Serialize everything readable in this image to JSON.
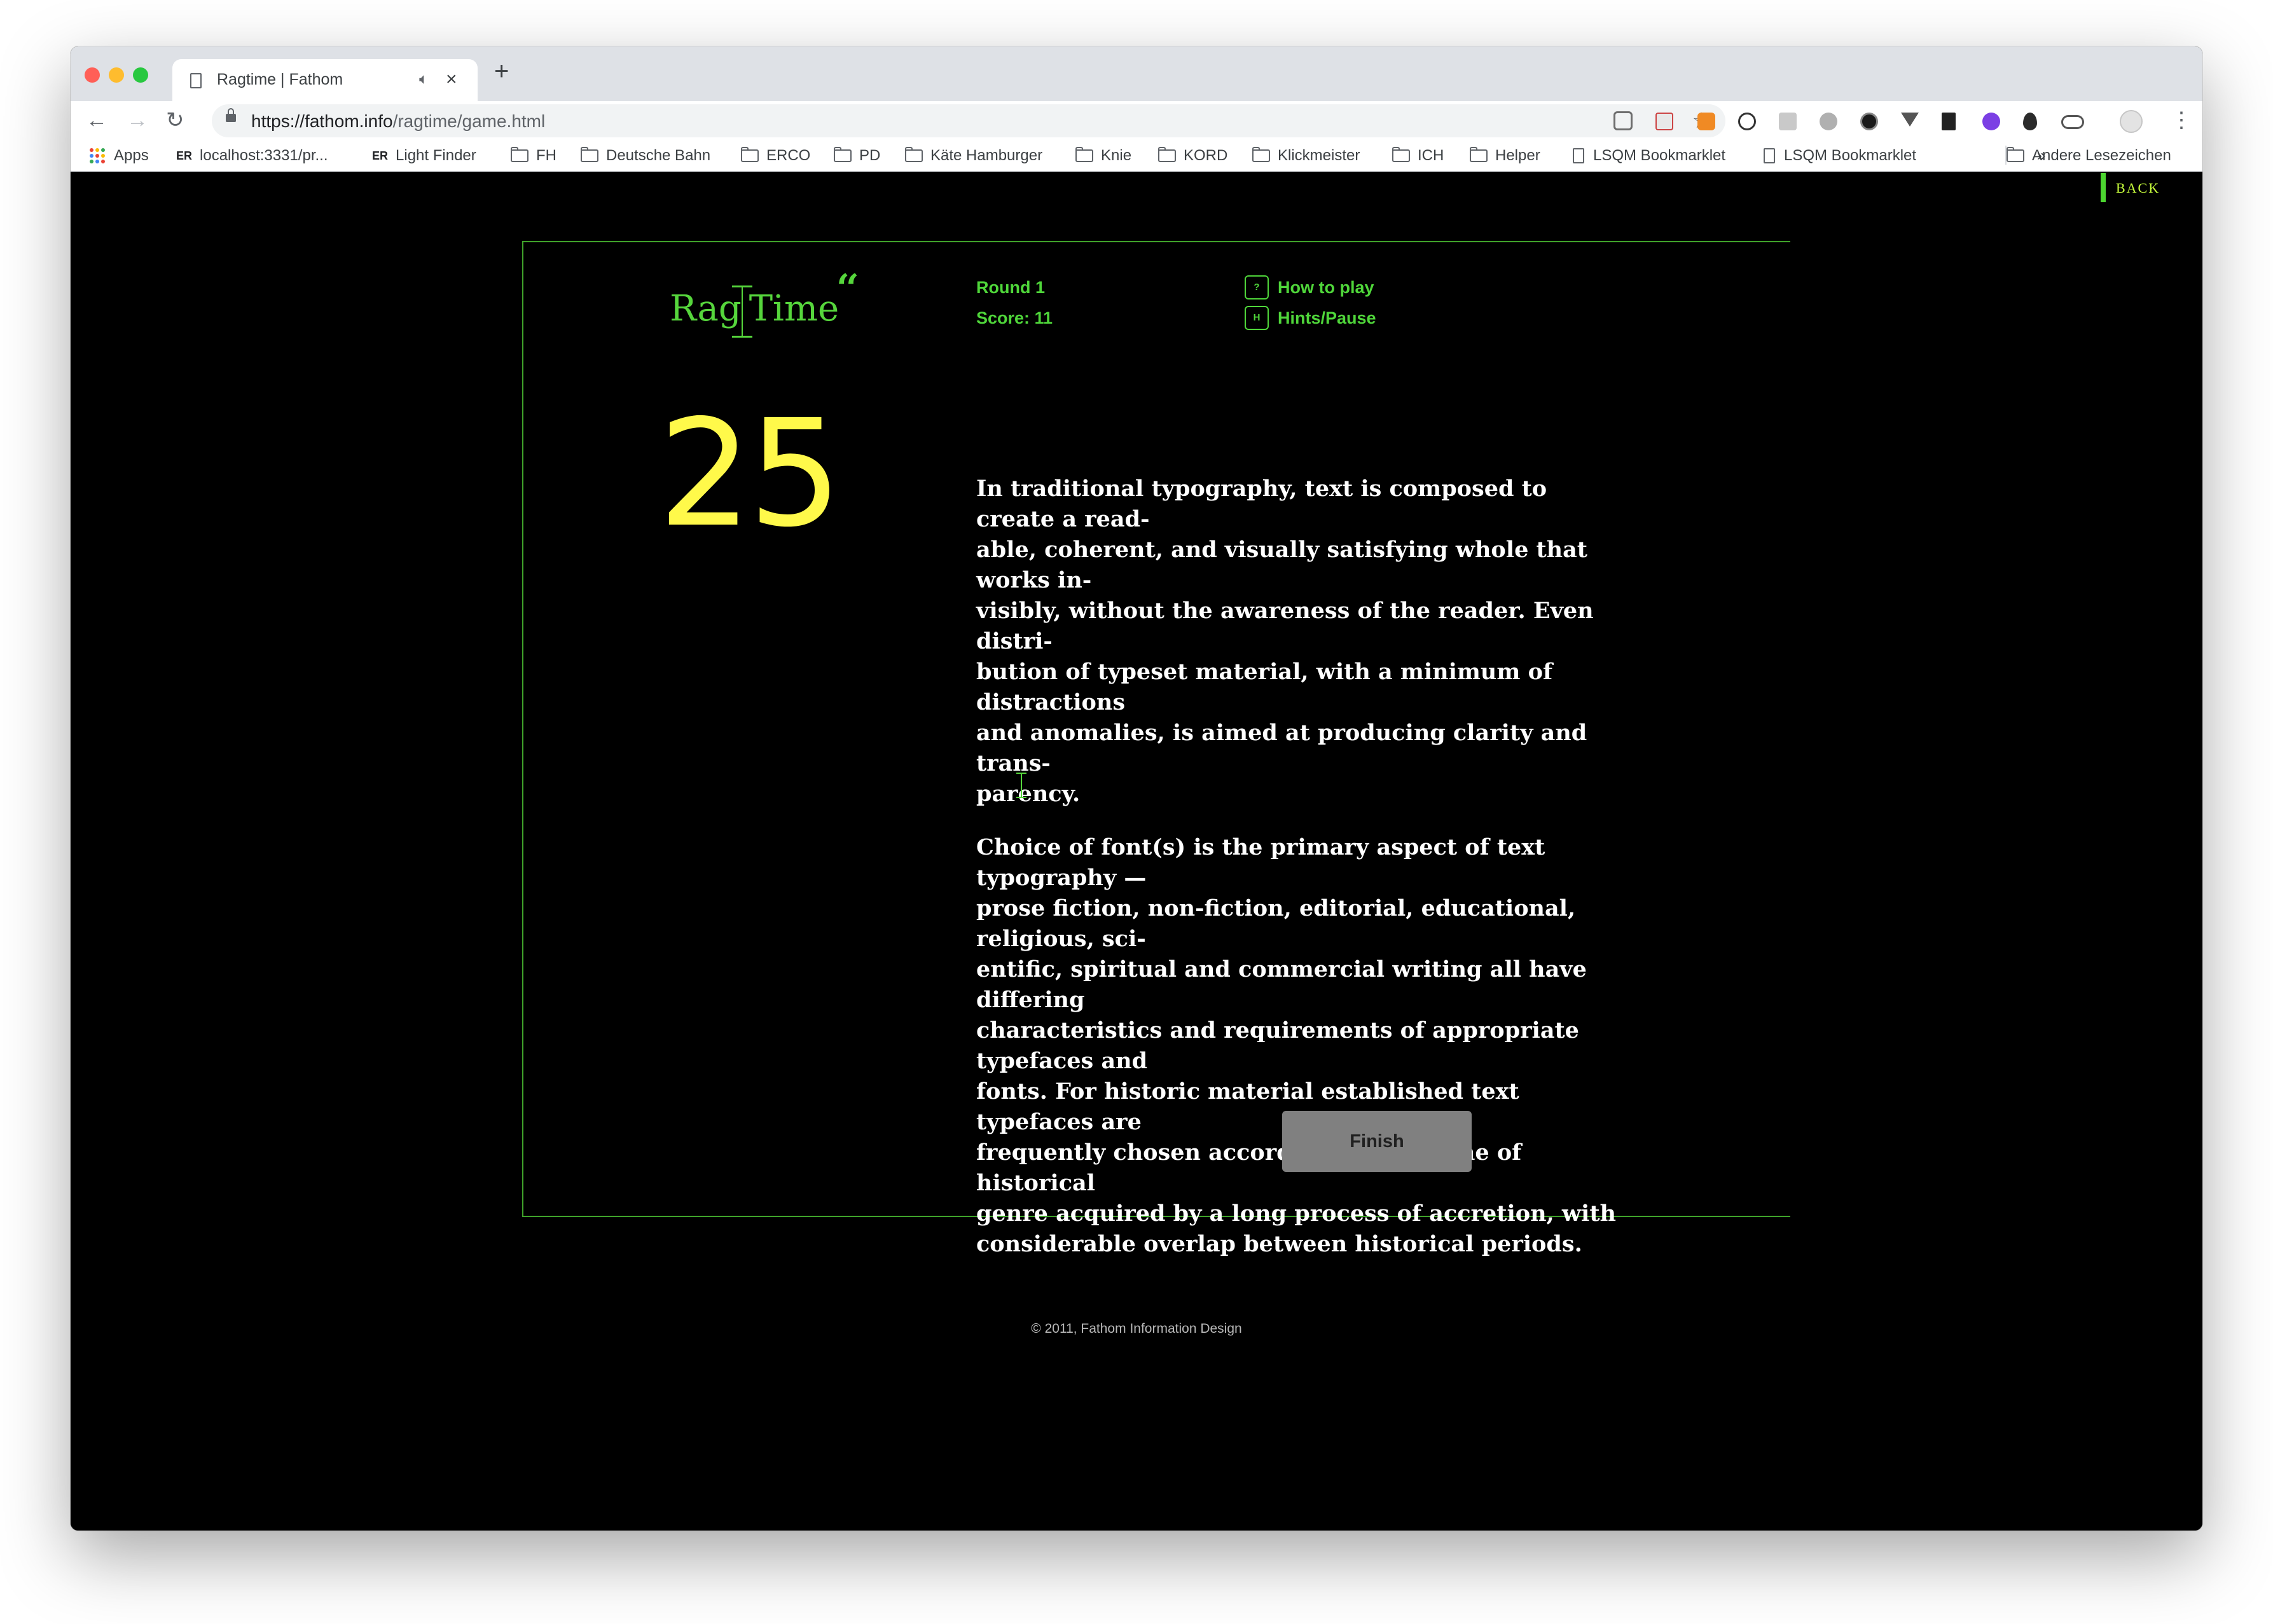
{
  "browser": {
    "tab_title": "Ragtime | Fathom",
    "tab_audio_icon": "speaker-icon",
    "tab_close": "×",
    "new_tab": "+",
    "url_host": "https://fathom.info",
    "url_path": "/ragtime/game.html",
    "nav": {
      "back": "←",
      "forward": "→",
      "reload": "↻"
    },
    "star": "☆",
    "menu": "⋮",
    "bookmarks": [
      {
        "label": "Apps",
        "icon": "apps-icon"
      },
      {
        "label": "localhost:3331/pr...",
        "icon": "er-icon"
      },
      {
        "label": "Light Finder",
        "icon": "er-icon"
      },
      {
        "label": "FH",
        "icon": "folder-icon"
      },
      {
        "label": "Deutsche Bahn",
        "icon": "folder-icon"
      },
      {
        "label": "ERCO",
        "icon": "folder-icon"
      },
      {
        "label": "PD",
        "icon": "folder-icon"
      },
      {
        "label": "Käte Hamburger",
        "icon": "folder-icon"
      },
      {
        "label": "Knie",
        "icon": "folder-icon"
      },
      {
        "label": "KORD",
        "icon": "folder-icon"
      },
      {
        "label": "Klickmeister",
        "icon": "folder-icon"
      },
      {
        "label": "ICH",
        "icon": "folder-icon"
      },
      {
        "label": "Helper",
        "icon": "folder-icon"
      },
      {
        "label": "LSQM Bookmarklet",
        "icon": "page-icon"
      },
      {
        "label": "LSQM Bookmarklet",
        "icon": "page-icon"
      }
    ],
    "bookmarks_overflow": "»",
    "other_bookmarks": "Andere Lesezeichen"
  },
  "page": {
    "back_link": "BACK",
    "logo": {
      "word1": "Rag",
      "word2": "Time",
      "quote": "‘‘"
    },
    "round": "Round 1",
    "score": "Score: 11",
    "help": [
      {
        "key": "?",
        "label": "How to play"
      },
      {
        "key": "H",
        "label": "Hints/Pause"
      }
    ],
    "timer": "25",
    "paragraphs": [
      "In traditional typography, text is composed to create a read-<br>able, coherent, and visually satisfying whole that works in-<br>visibly, without the awareness of the reader. Even distri-<br>bution of typeset material, with a minimum of distractions<br>and anomalies, is aimed at producing clarity and trans-<br>parency.",
      "Choice of font(s) is the primary aspect of text typography —<br>prose fiction, non-fiction, editorial, educational, religious, sci-<br>entific, spiritual and commercial writing all have differing<br>characteristics and requirements of appropriate typefaces and<br>fonts. For historic material established text typefaces are<br>frequently chosen according to a scheme of historical<br>genre acquired by a long process of accretion, with<br>considerable overlap between historical periods."
    ],
    "finish_label": "Finish",
    "footer": "© 2011, Fathom Information Design"
  },
  "colors": {
    "accent_green": "#4fd63a",
    "timer_yellow": "#fff94a",
    "text": "#ffffff",
    "button": "#808080"
  }
}
